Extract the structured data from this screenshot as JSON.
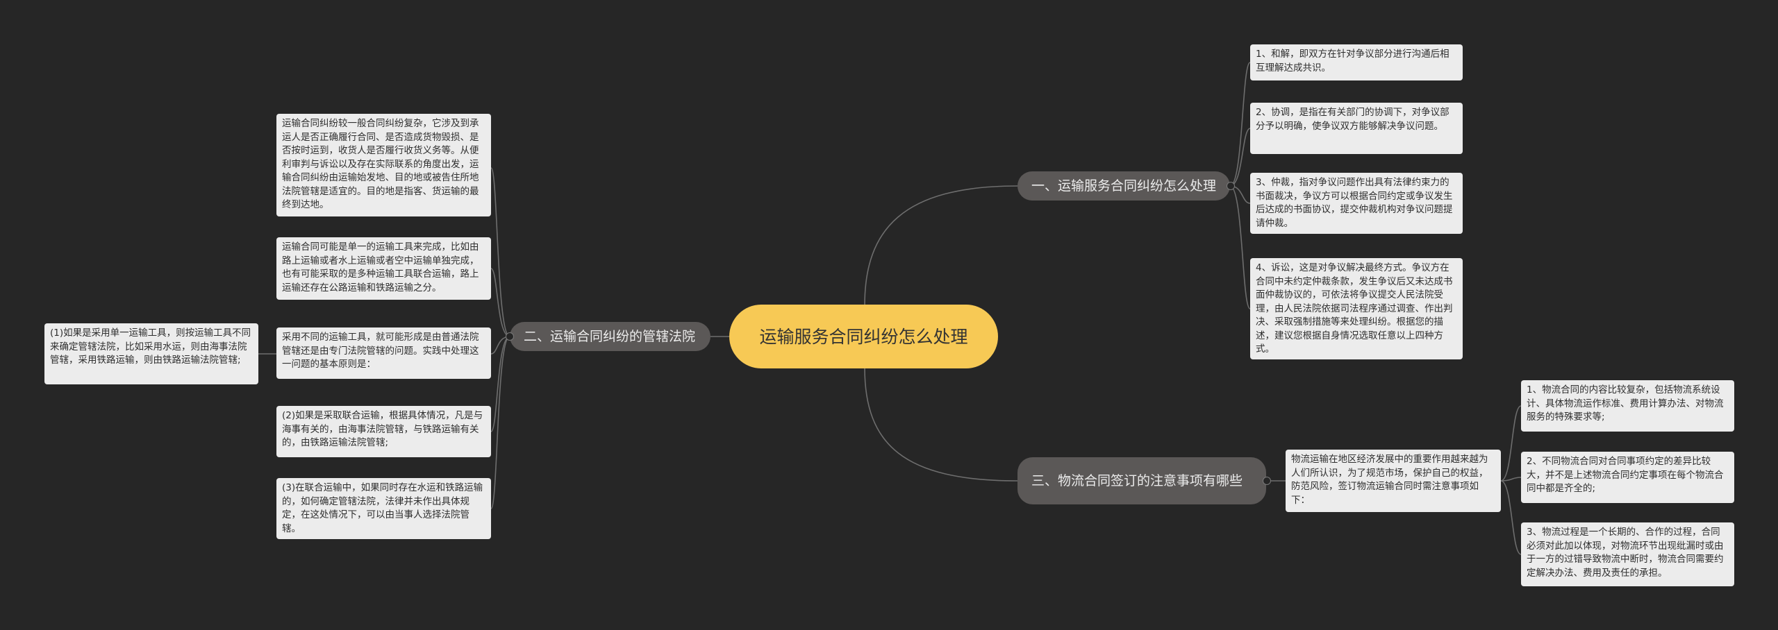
{
  "root": {
    "title": "运输服务合同纠纷怎么处理"
  },
  "branches": {
    "b1": {
      "label": "一、运输服务合同纠纷怎么处理",
      "items": [
        "1、和解，即双方在针对争议部分进行沟通后相互理解达成共识。",
        "2、协调，是指在有关部门的协调下，对争议部分予以明确，使争议双方能够解决争议问题。",
        "3、仲裁，指对争议问题作出具有法律约束力的书面裁决，争议方可以根据合同约定或争议发生后达成的书面协议，提交仲裁机构对争议问题提请仲裁。",
        "4、诉讼，这是对争议解决最终方式。争议方在合同中未约定仲裁条款，发生争议后又未达成书面仲裁协议的，可依法将争议提交人民法院受理，由人民法院依据司法程序通过调查、作出判决、采取强制措施等来处理纠纷。根据您的描述，建议您根据自身情况选取任意以上四种方式。"
      ]
    },
    "b2": {
      "label": "二、运输合同纠纷的管辖法院",
      "items": [
        "运输合同纠纷较一般合同纠纷复杂，它涉及到承运人是否正确履行合同、是否造成货物毁损、是否按时运到，收货人是否履行收货义务等。从便利审判与诉讼以及存在实际联系的角度出发，运输合同纠纷由运输始发地、目的地或被告住所地法院管辖是适宜的。目的地是指客、货运输的最终到达地。",
        "运输合同可能是单一的运输工具来完成，比如由路上运输或者水上运输或者空中运输单独完成，也有可能采取的是多种运输工具联合运输，路上运输还存在公路运输和铁路运输之分。",
        "采用不同的运输工具，就可能形成是由普通法院管辖还是由专门法院管辖的问题。实践中处理这一问题的基本原则是：",
        "(2)如果是采取联合运输，根据具体情况，凡是与海事有关的，由海事法院管辖，与铁路运输有关的，由铁路运输法院管辖;",
        "(3)在联合运输中，如果同时存在水运和铁路运输的，如何确定管辖法院，法律并未作出具体规定，在这处情况下，可以由当事人选择法院管辖。"
      ],
      "sub_item": "(1)如果是采用单一运输工具，则按运输工具不同来确定管辖法院，比如采用水运，则由海事法院管辖，采用铁路运输，则由铁路运输法院管辖;"
    },
    "b3": {
      "label": "三、物流合同签订的注意事项有哪些",
      "intro": "物流运输在地区经济发展中的重要作用越来越为人们所认识，为了规范市场，保护自己的权益，防范风险，签订物流运输合同时需注意事项如下：",
      "items": [
        "1、物流合同的内容比较复杂，包括物流系统设计、具体物流运作标准、费用计算办法、对物流服务的特殊要求等;",
        "2、不同物流合同对合同事项约定的差异比较大，并不是上述物流合同约定事项在每个物流合同中都是齐全的;",
        "3、物流过程是一个长期的、合作的过程，合同必须对此加以体现，对物流环节出现纰漏时或由于一方的过错导致物流中断时，物流合同需要约定解决办法、费用及责任的承担。"
      ]
    }
  }
}
